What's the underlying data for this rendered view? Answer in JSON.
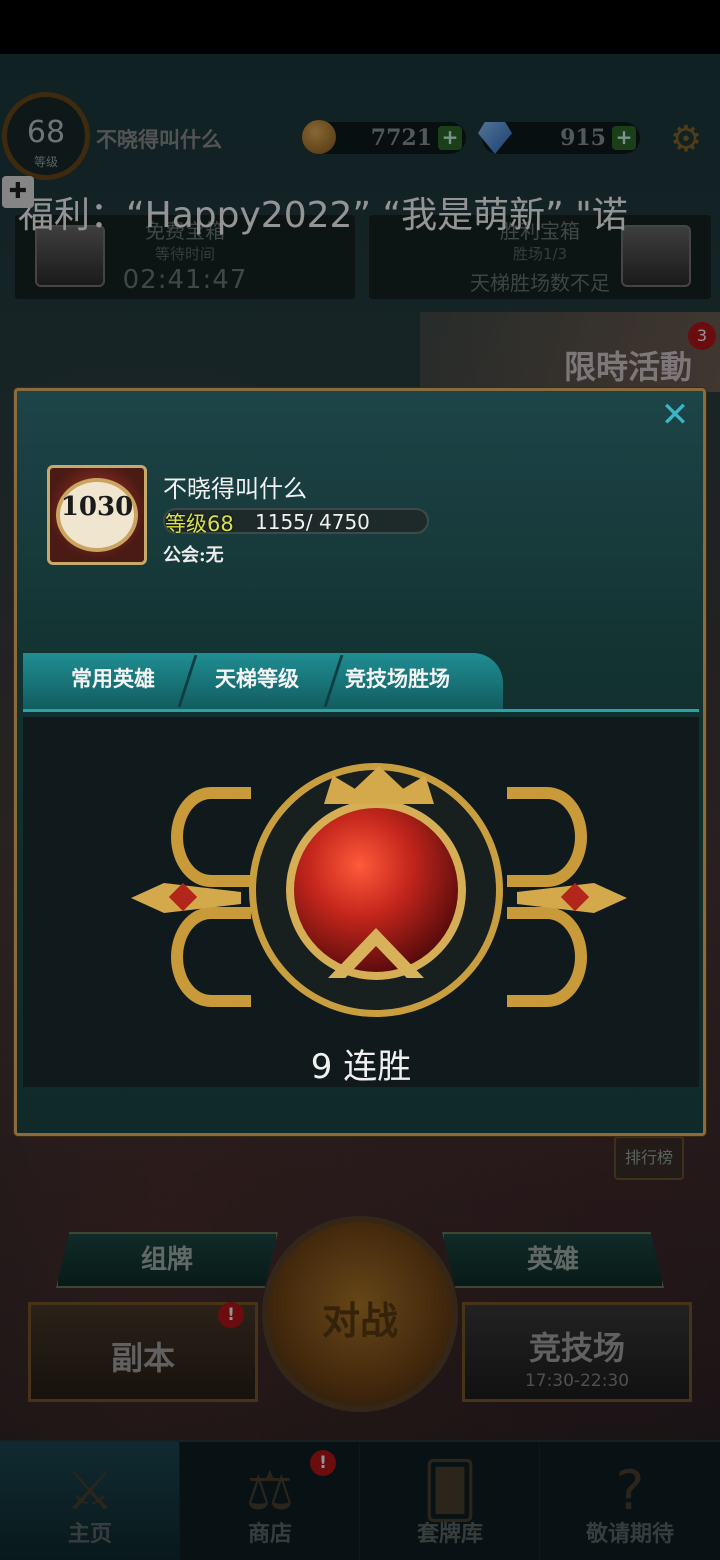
{
  "hud": {
    "level": "68",
    "level_label": "等级",
    "player_name": "不晓得叫什么",
    "coins": "7721",
    "gems": "915"
  },
  "marquee": "福利：“Happy2022” “我是萌新” \"诺",
  "chests": {
    "free": {
      "title": "免费宝箱",
      "subtitle": "等待时间",
      "timer": "02:41:47"
    },
    "win": {
      "title": "胜利宝箱",
      "subtitle": "胜场1/3",
      "message": "天梯胜场数不足"
    }
  },
  "event": {
    "label": "限時活動",
    "badge": "3"
  },
  "profile": {
    "avatar_number": "1030",
    "name": "不晓得叫什么",
    "level_text": "等级68",
    "xp_text": "1155/ 4750",
    "guild": "公会:无",
    "tabs": [
      "常用英雄",
      "天梯等级",
      "竞技场胜场"
    ],
    "active_tab": "竞技场胜场",
    "streak": "9 连胜"
  },
  "menu": {
    "ranking": "排行榜",
    "deck": "组牌",
    "hero": "英雄",
    "battle": "对战",
    "dungeon": "副本",
    "dungeon_badge": "!",
    "arena": "竞技场",
    "arena_time": "17:30-22:30"
  },
  "nav": {
    "items": [
      "主页",
      "商店",
      "套牌库",
      "敬请期待"
    ],
    "active": "主页",
    "shop_badge": "!"
  },
  "colors": {
    "accent": "#2aa3a8",
    "modal_border": "#8b6a3b",
    "level_text": "#d7e04a",
    "badge": "#b8151a"
  }
}
